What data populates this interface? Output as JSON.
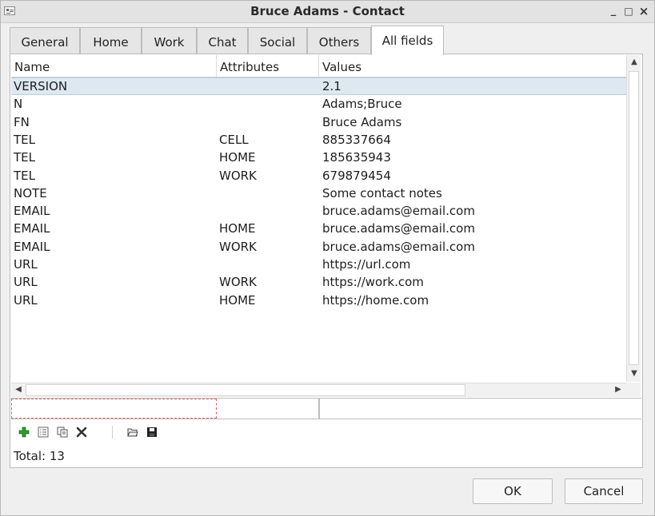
{
  "window": {
    "title": "Bruce Adams - Contact",
    "controls": {
      "minimize": "_",
      "maximize": "□",
      "close": "×"
    }
  },
  "tabs": [
    {
      "label": "General"
    },
    {
      "label": "Home"
    },
    {
      "label": "Work"
    },
    {
      "label": "Chat"
    },
    {
      "label": "Social"
    },
    {
      "label": "Others"
    },
    {
      "label": "All fields",
      "active": true
    }
  ],
  "table": {
    "columns": [
      "Name",
      "Attributes",
      "Values"
    ],
    "rows": [
      {
        "name": "VERSION",
        "attributes": "",
        "value": "2.1",
        "selected": true
      },
      {
        "name": "N",
        "attributes": "",
        "value": "Adams;Bruce"
      },
      {
        "name": "FN",
        "attributes": "",
        "value": "Bruce Adams"
      },
      {
        "name": "TEL",
        "attributes": "CELL",
        "value": "885337664"
      },
      {
        "name": "TEL",
        "attributes": "HOME",
        "value": "185635943"
      },
      {
        "name": "TEL",
        "attributes": "WORK",
        "value": "679879454"
      },
      {
        "name": "NOTE",
        "attributes": "",
        "value": "Some contact notes"
      },
      {
        "name": "EMAIL",
        "attributes": "",
        "value": "bruce.adams@email.com"
      },
      {
        "name": "EMAIL",
        "attributes": "HOME",
        "value": "bruce.adams@email.com"
      },
      {
        "name": "EMAIL",
        "attributes": "WORK",
        "value": "bruce.adams@email.com"
      },
      {
        "name": "URL",
        "attributes": "",
        "value": "https://url.com"
      },
      {
        "name": "URL",
        "attributes": "WORK",
        "value": "https://work.com"
      },
      {
        "name": "URL",
        "attributes": "HOME",
        "value": "https://home.com"
      }
    ]
  },
  "editor": {
    "name_value": "",
    "attributes_value": "",
    "value_value": ""
  },
  "toolbar": {
    "icons": [
      "add-icon",
      "properties-icon",
      "copy-icon",
      "delete-icon",
      "open-folder-icon",
      "save-icon"
    ],
    "colors": {
      "add": "#2e9b2e",
      "delete": "#333333"
    }
  },
  "status": {
    "total": "Total: 13"
  },
  "buttons": {
    "ok": "OK",
    "cancel": "Cancel"
  },
  "colors": {
    "selection": "#dde8f0",
    "background": "#efefef"
  }
}
